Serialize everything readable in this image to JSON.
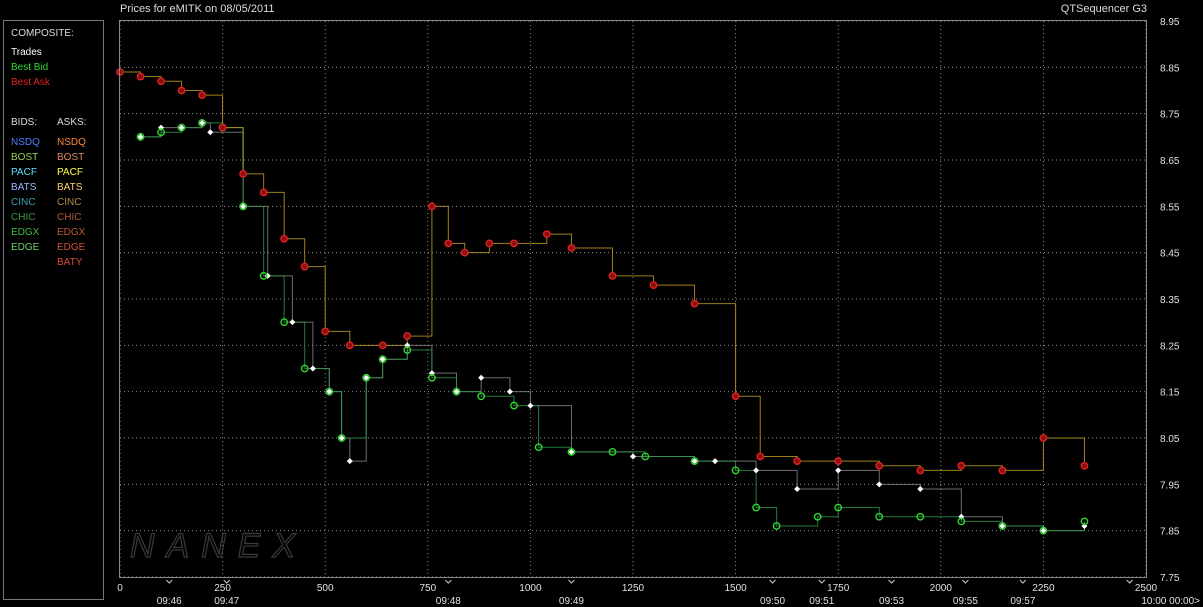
{
  "header": {
    "title": "Prices for  eMITK  on  08/05/2011",
    "app": "QTSequencer G3"
  },
  "legend": {
    "composite_label": "COMPOSITE:",
    "composite": [
      {
        "label": "Trades",
        "color": "#ffffff"
      },
      {
        "label": "Best Bid",
        "color": "#2ed82e"
      },
      {
        "label": "Best Ask",
        "color": "#e02020"
      }
    ],
    "bids_header": "BIDS:",
    "asks_header": "ASKS:",
    "bids": [
      {
        "label": "NSDQ",
        "color": "#4a7cff"
      },
      {
        "label": "BOST",
        "color": "#9bd15a"
      },
      {
        "label": "PACF",
        "color": "#5ee0ff"
      },
      {
        "label": "BATS",
        "color": "#9ab8ff"
      },
      {
        "label": "CINC",
        "color": "#3aa0b0"
      },
      {
        "label": "CHIC",
        "color": "#3f9a3f"
      },
      {
        "label": "EDGX",
        "color": "#3fbf3f"
      },
      {
        "label": "EDGE",
        "color": "#6fd06f"
      }
    ],
    "asks": [
      {
        "label": "NSDQ",
        "color": "#ff8a3a"
      },
      {
        "label": "BOST",
        "color": "#e08a5a"
      },
      {
        "label": "PACF",
        "color": "#ffff40"
      },
      {
        "label": "BATS",
        "color": "#ffd070"
      },
      {
        "label": "CINC",
        "color": "#b08a50"
      },
      {
        "label": "CHIC",
        "color": "#b05a3a"
      },
      {
        "label": "EDGX",
        "color": "#c0583a"
      },
      {
        "label": "EDGE",
        "color": "#d0503a"
      },
      {
        "label": "BATY",
        "color": "#e04a3a"
      }
    ]
  },
  "watermark": "NANEX",
  "chart_data": {
    "type": "line",
    "title": "Prices for  eMITK  on  08/05/2011",
    "ylim": [
      7.75,
      8.95
    ],
    "xlim": [
      0,
      2500
    ],
    "y_ticks": [
      "8.95",
      "8.85",
      "8.75",
      "8.65",
      "8.55",
      "8.45",
      "8.35",
      "8.25",
      "8.15",
      "8.05",
      "7.95",
      "7.85",
      "7.75"
    ],
    "x_ticks": [
      {
        "seq": 0,
        "label": "0"
      },
      {
        "seq": 250,
        "label": "250"
      },
      {
        "seq": 500,
        "label": "500"
      },
      {
        "seq": 750,
        "label": "750"
      },
      {
        "seq": 1000,
        "label": "1000"
      },
      {
        "seq": 1250,
        "label": "1250"
      },
      {
        "seq": 1500,
        "label": "1500"
      },
      {
        "seq": 1750,
        "label": "1750"
      },
      {
        "seq": 2000,
        "label": "2000"
      },
      {
        "seq": 2250,
        "label": "2250"
      },
      {
        "seq": 2500,
        "label": "2500"
      }
    ],
    "time_ticks": [
      {
        "seq": 120,
        "label": "09:46"
      },
      {
        "seq": 260,
        "label": "09:47"
      },
      {
        "seq": 800,
        "label": "09:48"
      },
      {
        "seq": 1100,
        "label": "09:49"
      },
      {
        "seq": 1590,
        "label": "09:50"
      },
      {
        "seq": 1710,
        "label": "09:51"
      },
      {
        "seq": 1880,
        "label": "09:53"
      },
      {
        "seq": 2060,
        "label": "09:55"
      },
      {
        "seq": 2200,
        "label": "09:57"
      },
      {
        "seq": 2460,
        "label": "10:00 00:00>"
      }
    ],
    "grid": true,
    "series": [
      {
        "name": "Trades",
        "color": "#ffffff",
        "x": [
          50,
          100,
          150,
          200,
          220,
          300,
          360,
          420,
          470,
          510,
          540,
          560,
          600,
          640,
          700,
          760,
          820,
          880,
          950,
          1000,
          1100,
          1250,
          1400,
          1450,
          1550,
          1650,
          1750,
          1850,
          1950,
          2050,
          2150,
          2250,
          2350
        ],
        "y": [
          8.7,
          8.72,
          8.72,
          8.73,
          8.71,
          8.55,
          8.4,
          8.3,
          8.2,
          8.15,
          8.05,
          8.0,
          8.18,
          8.22,
          8.25,
          8.19,
          8.15,
          8.18,
          8.15,
          8.12,
          8.02,
          8.01,
          8.0,
          8.0,
          7.98,
          7.94,
          7.98,
          7.95,
          7.94,
          7.88,
          7.86,
          7.85,
          7.86
        ]
      },
      {
        "name": "Best Bid",
        "color": "#2ed82e",
        "x": [
          50,
          100,
          150,
          200,
          250,
          300,
          350,
          400,
          450,
          510,
          540,
          600,
          640,
          700,
          760,
          820,
          880,
          960,
          1020,
          1100,
          1200,
          1280,
          1400,
          1500,
          1550,
          1600,
          1700,
          1750,
          1850,
          1950,
          2050,
          2150,
          2250,
          2350
        ],
        "y": [
          8.7,
          8.71,
          8.72,
          8.73,
          8.72,
          8.55,
          8.4,
          8.3,
          8.2,
          8.15,
          8.05,
          8.18,
          8.22,
          8.24,
          8.18,
          8.15,
          8.14,
          8.12,
          8.03,
          8.02,
          8.02,
          8.01,
          8.0,
          7.98,
          7.9,
          7.86,
          7.88,
          7.9,
          7.88,
          7.88,
          7.87,
          7.86,
          7.85,
          7.87
        ]
      },
      {
        "name": "Best Ask",
        "color": "#e02020",
        "x": [
          0,
          50,
          100,
          150,
          200,
          250,
          300,
          350,
          400,
          450,
          500,
          560,
          640,
          700,
          760,
          800,
          840,
          900,
          960,
          1040,
          1100,
          1200,
          1300,
          1400,
          1500,
          1560,
          1650,
          1750,
          1850,
          1950,
          2050,
          2150,
          2250,
          2350
        ],
        "y": [
          8.84,
          8.83,
          8.82,
          8.8,
          8.79,
          8.72,
          8.62,
          8.58,
          8.48,
          8.42,
          8.28,
          8.25,
          8.25,
          8.27,
          8.55,
          8.47,
          8.45,
          8.47,
          8.47,
          8.49,
          8.46,
          8.4,
          8.38,
          8.34,
          8.14,
          8.01,
          8.0,
          8.0,
          7.99,
          7.98,
          7.99,
          7.98,
          8.05,
          7.99
        ]
      }
    ]
  }
}
